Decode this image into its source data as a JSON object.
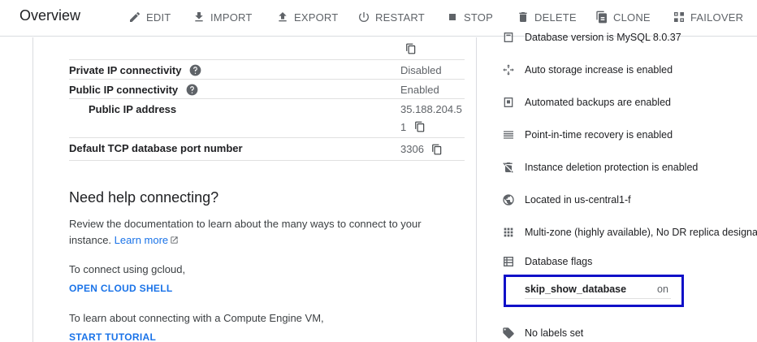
{
  "header": {
    "title": "Overview",
    "actions": {
      "edit": "EDIT",
      "import": "IMPORT",
      "export": "EXPORT",
      "restart": "RESTART",
      "stop": "STOP",
      "delete": "DELETE",
      "clone": "CLONE",
      "failover": "FAILOVER"
    }
  },
  "connectivity": {
    "private_ip": {
      "label": "Private IP connectivity",
      "value": "Disabled"
    },
    "public_ip": {
      "label": "Public IP connectivity",
      "value": "Enabled"
    },
    "public_ip_address": {
      "label": "Public IP address",
      "value_line1": "35.188.204.5",
      "value_line2": "1"
    },
    "tcp_port": {
      "label": "Default TCP database port number",
      "value": "3306"
    }
  },
  "help": {
    "heading": "Need help connecting?",
    "doc_text_1": "Review the documentation to learn about the many ways to connect to your",
    "doc_text_2": "instance.",
    "learn_more": "Learn more",
    "gcloud_text": "To connect using gcloud,",
    "open_cloud_shell": "OPEN CLOUD SHELL",
    "vm_text": "To learn about connecting with a Compute Engine VM,",
    "start_tutorial": "START TUTORIAL"
  },
  "config": {
    "db_version": "Database version is MySQL 8.0.37",
    "auto_storage": "Auto storage increase is enabled",
    "backups": "Automated backups are enabled",
    "pitr": "Point-in-time recovery is enabled",
    "deletion_protection": "Instance deletion protection is enabled",
    "location": "Located in us-central1-f",
    "availability": "Multi-zone (highly available), No DR replica designated",
    "flags_title": "Database flags",
    "flag": {
      "name": "skip_show_database",
      "value": "on"
    },
    "labels": "No labels set"
  },
  "colors": {
    "accent": "#1a73e8",
    "highlight_box": "#1010c8",
    "icon": "#5f6368"
  }
}
